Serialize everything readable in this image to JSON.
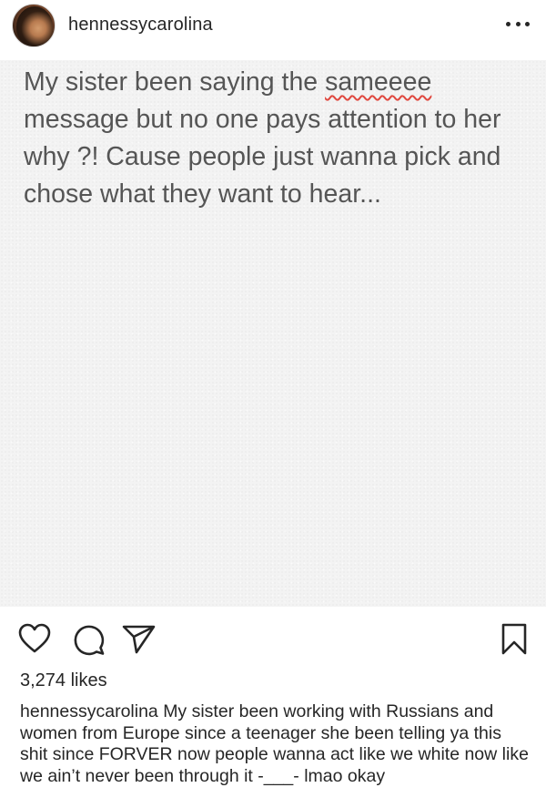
{
  "header": {
    "username": "hennessycarolina"
  },
  "post_image": {
    "text_parts": [
      "My sister been saying the ",
      "sameeee",
      " message but no one pays attention to her why ?! Cause people just wanna pick and chose what they want to hear..."
    ]
  },
  "actions": {
    "like_icon": "heart-icon",
    "comment_icon": "comment-icon",
    "share_icon": "paper-plane-icon",
    "save_icon": "bookmark-icon"
  },
  "likes": "3,274 likes",
  "caption": {
    "username": "hennessycarolina",
    "text": "My sister been working with Russians and women from Europe since a teenager she been telling ya this shit since FORVER now people wanna act like we white now like we ain’t never been through it -___- lmao okay"
  },
  "colors": {
    "text_primary": "#262626",
    "image_text": "#555555",
    "image_background": "#f3f3f3",
    "spellcheck_underline": "#e0483f"
  }
}
